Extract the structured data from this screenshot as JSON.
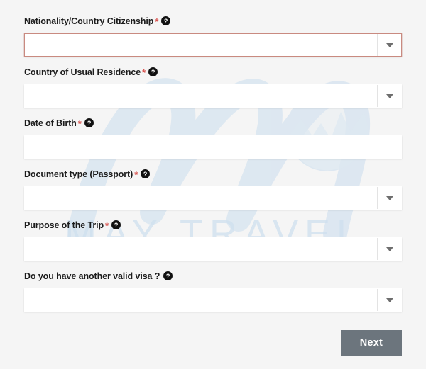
{
  "page": {
    "background_color": "#f5f5f5",
    "required_marker": "*",
    "required_marker_color": "#d9534f",
    "help_icon_name": "help-circle-icon"
  },
  "watermark": {
    "brand_text": "MAY TRAVEL",
    "logo_letter": "M",
    "color": "#cfe0ef"
  },
  "form": {
    "fields": [
      {
        "label": "Nationality/Country Citizenship",
        "required": true,
        "value": "",
        "placeholder": "",
        "type": "select",
        "has_caret": true,
        "error": true,
        "name": "nationality-country-citizenship"
      },
      {
        "label": "Country of Usual Residence",
        "required": true,
        "value": "",
        "placeholder": "",
        "type": "select",
        "has_caret": true,
        "error": false,
        "name": "country-of-usual-residence"
      },
      {
        "label": "Date of Birth",
        "required": true,
        "value": "",
        "placeholder": "",
        "type": "text",
        "has_caret": false,
        "error": false,
        "name": "date-of-birth"
      },
      {
        "label": "Document type (Passport)",
        "required": true,
        "value": "",
        "placeholder": "",
        "type": "select",
        "has_caret": true,
        "error": false,
        "name": "document-type-passport"
      },
      {
        "label": "Purpose of the Trip",
        "required": true,
        "value": "",
        "placeholder": "",
        "type": "select",
        "has_caret": true,
        "error": false,
        "name": "purpose-of-the-trip"
      },
      {
        "label": "Do you have another valid visa ?",
        "required": false,
        "value": "",
        "placeholder": "",
        "type": "select",
        "has_caret": true,
        "error": false,
        "name": "another-valid-visa"
      }
    ]
  },
  "footer": {
    "next_label": "Next",
    "next_color": "#6c757d"
  }
}
